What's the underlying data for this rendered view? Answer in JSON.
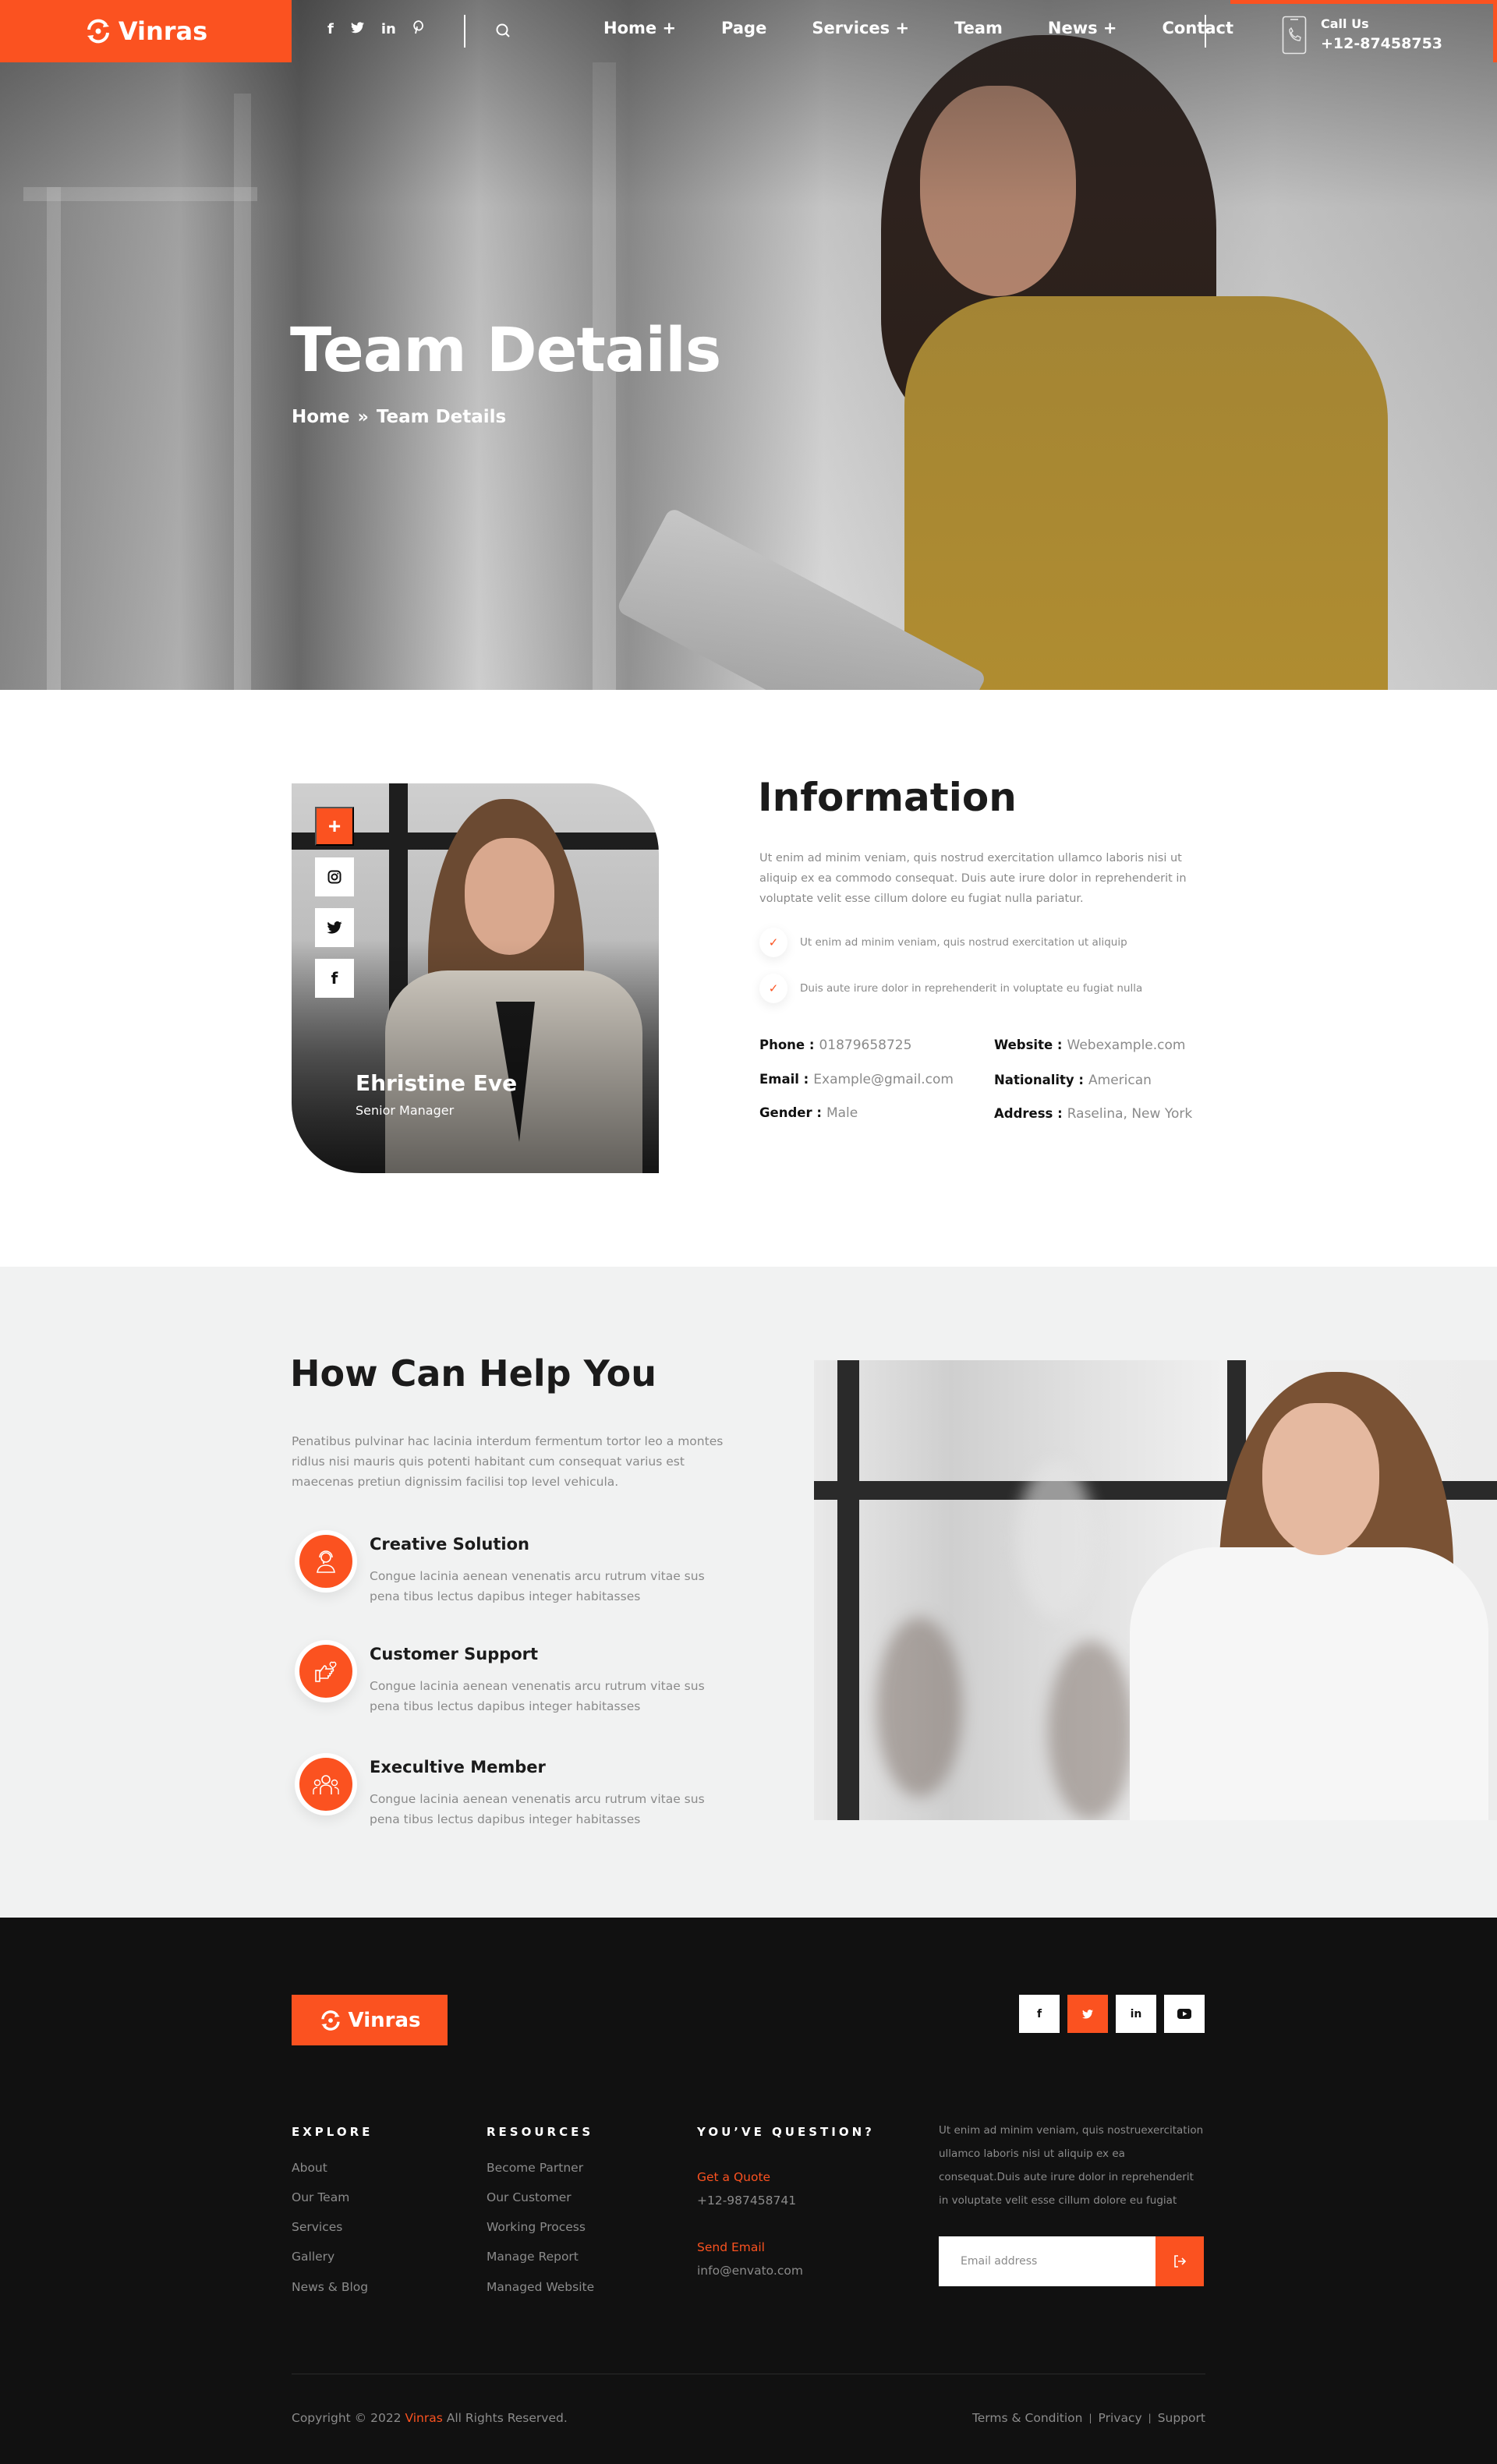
{
  "brand": {
    "name": "Vinras",
    "accent": "#fb5220"
  },
  "header": {
    "socials": [
      {
        "icon": "facebook-icon",
        "glyph": "f"
      },
      {
        "icon": "twitter-icon",
        "glyph": "🐦"
      },
      {
        "icon": "linkedin-icon",
        "glyph": "in"
      },
      {
        "icon": "pinterest-icon",
        "glyph": "℗"
      }
    ],
    "nav": [
      "Home +",
      "Page",
      "Services +",
      "Team",
      "News +",
      "Contact"
    ],
    "call": {
      "label": "Call Us",
      "number": "+12-87458753"
    }
  },
  "hero": {
    "title": "Team Details",
    "breadcrumb": {
      "home": "Home",
      "separator": "»",
      "current": "Team Details"
    }
  },
  "profile": {
    "name": "Ehristine Eve",
    "role": "Senior Manager",
    "social_buttons": [
      {
        "icon": "plus-icon",
        "glyph": "+"
      },
      {
        "icon": "instagram-icon",
        "glyph": "◎"
      },
      {
        "icon": "twitter-icon",
        "glyph": "🐦"
      },
      {
        "icon": "facebook-icon",
        "glyph": "f"
      }
    ]
  },
  "information": {
    "title": "Information",
    "description": "Ut enim ad minim veniam, quis nostrud exercitation ullamco laboris nisi ut aliquip ex ea commodo consequat. Duis aute irure dolor in reprehenderit in voluptate velit esse cillum dolore eu fugiat nulla pariatur.",
    "checks": [
      "Ut enim ad minim veniam, quis nostrud exercitation ut aliquip",
      "Duis aute irure dolor in reprehenderit in voluptate eu fugiat nulla"
    ],
    "check_glyph": "✓",
    "details": [
      {
        "label": "Phone :",
        "value": "01879658725"
      },
      {
        "label": "Website :",
        "value": "Webexample.com"
      },
      {
        "label": "Email :",
        "value": "Example@gmail.com"
      },
      {
        "label": "Nationality :",
        "value": "American"
      },
      {
        "label": "Gender :",
        "value": "Male"
      },
      {
        "label": "Address :",
        "value": "Raselina, New York"
      }
    ]
  },
  "help": {
    "title": "How Can Help You",
    "description": "Penatibus pulvinar hac lacinia interdum fermentum tortor leo a montes ridlus nisi mauris quis potenti habitant cum consequat varius est maecenas pretiun dignissim facilisi  top level vehicula.",
    "features": [
      {
        "title": "Creative Solution",
        "description": "Congue lacinia aenean venenatis arcu rutrum vitae sus pena tibus lectus dapibus integer habitasses",
        "icon": "headset-agent-icon"
      },
      {
        "title": "Customer Support",
        "description": "Congue lacinia aenean venenatis arcu rutrum vitae sus pena tibus lectus dapibus integer habitasses",
        "icon": "hand-heart-icon"
      },
      {
        "title": "Execultive Member",
        "description": "Congue lacinia aenean venenatis arcu rutrum vitae sus pena tibus lectus dapibus integer habitasses",
        "icon": "team-group-icon"
      }
    ]
  },
  "footer": {
    "socials": [
      {
        "icon": "facebook-icon",
        "glyph": "f",
        "active": false
      },
      {
        "icon": "twitter-icon",
        "glyph": "🐦",
        "active": true
      },
      {
        "icon": "linkedin-icon",
        "glyph": "in",
        "active": false
      },
      {
        "icon": "youtube-icon",
        "glyph": "▶",
        "active": false
      }
    ],
    "explore": {
      "heading": "EXPLORE",
      "links": [
        "About",
        "Our Team",
        "Services",
        "Gallery",
        "News & Blog"
      ]
    },
    "resources": {
      "heading": "RESOURCES",
      "links": [
        "Become Partner",
        "Our Customer",
        "Working Process",
        "Manage Report",
        "Managed Website"
      ]
    },
    "question": {
      "heading": "YOU’VE QUESTION?",
      "quote_label": "Get a Quote",
      "quote_phone": "+12-987458741",
      "email_label": "Send Email",
      "email": "info@envato.com"
    },
    "about": "Ut enim ad minim veniam, quis nostruexercitation ullamco laboris nisi ut aliquip ex ea consequat.Duis aute irure dolor in reprehenderit in voluptate velit esse cillum dolore eu fugiat",
    "newsletter": {
      "placeholder": "Email address",
      "button_glyph": "⇥"
    },
    "copyright_prefix": "Copyright © 2022 ",
    "copyright_brand": "Vinras",
    "copyright_suffix": " All Rights Reserved.",
    "legal": [
      "Terms & Condition",
      "Privacy",
      "Support"
    ]
  }
}
